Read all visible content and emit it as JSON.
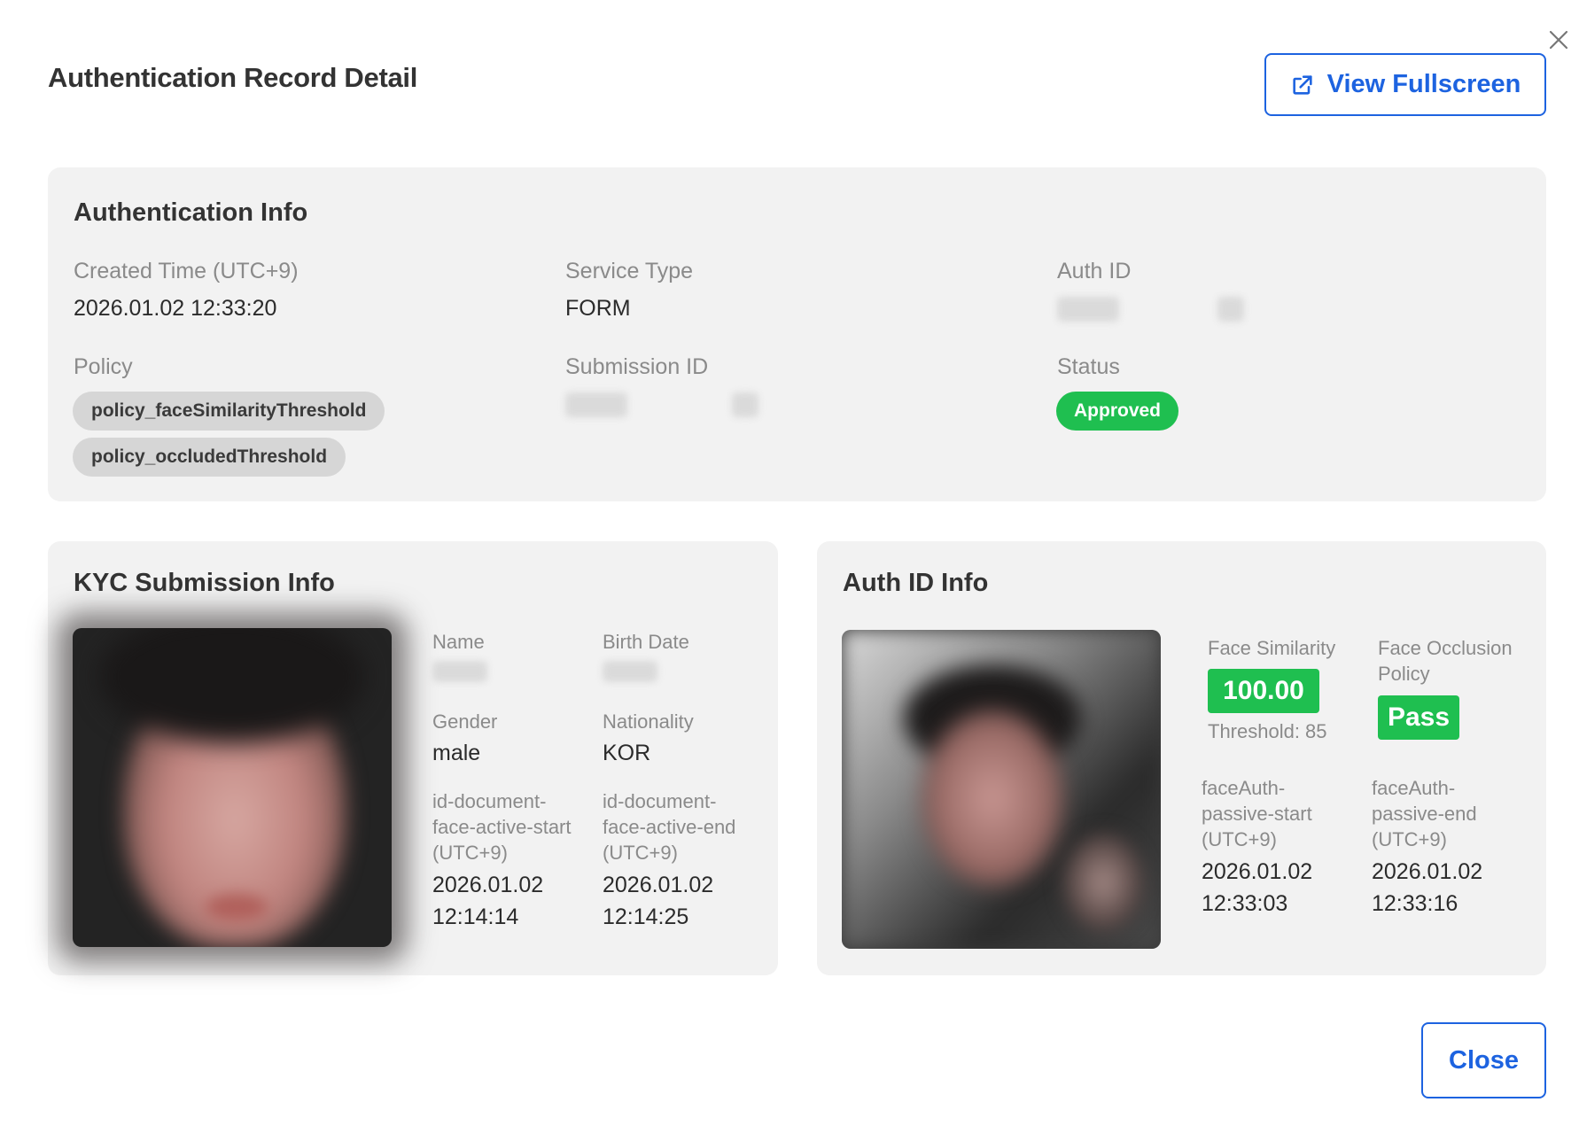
{
  "modal": {
    "title": "Authentication Record Detail",
    "view_fullscreen_label": "View Fullscreen",
    "close_label": "Close"
  },
  "auth_info": {
    "title": "Authentication Info",
    "created_time_label": "Created Time (UTC+9)",
    "created_time_value": "2026.01.02 12:33:20",
    "service_type_label": "Service Type",
    "service_type_value": "FORM",
    "auth_id_label": "Auth ID",
    "policy_label": "Policy",
    "policies": [
      "policy_faceSimilarityThreshold",
      "policy_occludedThreshold"
    ],
    "submission_id_label": "Submission ID",
    "status_label": "Status",
    "status_value": "Approved"
  },
  "kyc_info": {
    "title": "KYC Submission Info",
    "name_label": "Name",
    "birth_date_label": "Birth Date",
    "gender_label": "Gender",
    "gender_value": "male",
    "nationality_label": "Nationality",
    "nationality_value": "KOR",
    "face_start_label": [
      "id-document-",
      "face-active-start",
      "(UTC+9)"
    ],
    "face_start_value": [
      "2026.01.02",
      "12:14:14"
    ],
    "face_end_label": [
      "id-document-",
      "face-active-end",
      "(UTC+9)"
    ],
    "face_end_value": [
      "2026.01.02",
      "12:14:25"
    ]
  },
  "authid_info": {
    "title": "Auth ID Info",
    "face_similarity_label": "Face Similarity",
    "face_similarity_value": "100.00",
    "threshold_text": "Threshold: 85",
    "occlusion_label": [
      "Face Occlusion",
      "Policy"
    ],
    "occlusion_value": "Pass",
    "passive_start_label": [
      "faceAuth-",
      "passive-start",
      "(UTC+9)"
    ],
    "passive_start_value": [
      "2026.01.02",
      "12:33:03"
    ],
    "passive_end_label": [
      "faceAuth-",
      "passive-end",
      "(UTC+9)"
    ],
    "passive_end_value": [
      "2026.01.02",
      "12:33:16"
    ]
  },
  "colors": {
    "accent": "#1d63e0",
    "success": "#1fbf50",
    "card_bg": "#f2f2f2",
    "chip_bg": "#d6d6d6"
  },
  "icons": [
    "close-icon",
    "external-link-icon"
  ]
}
